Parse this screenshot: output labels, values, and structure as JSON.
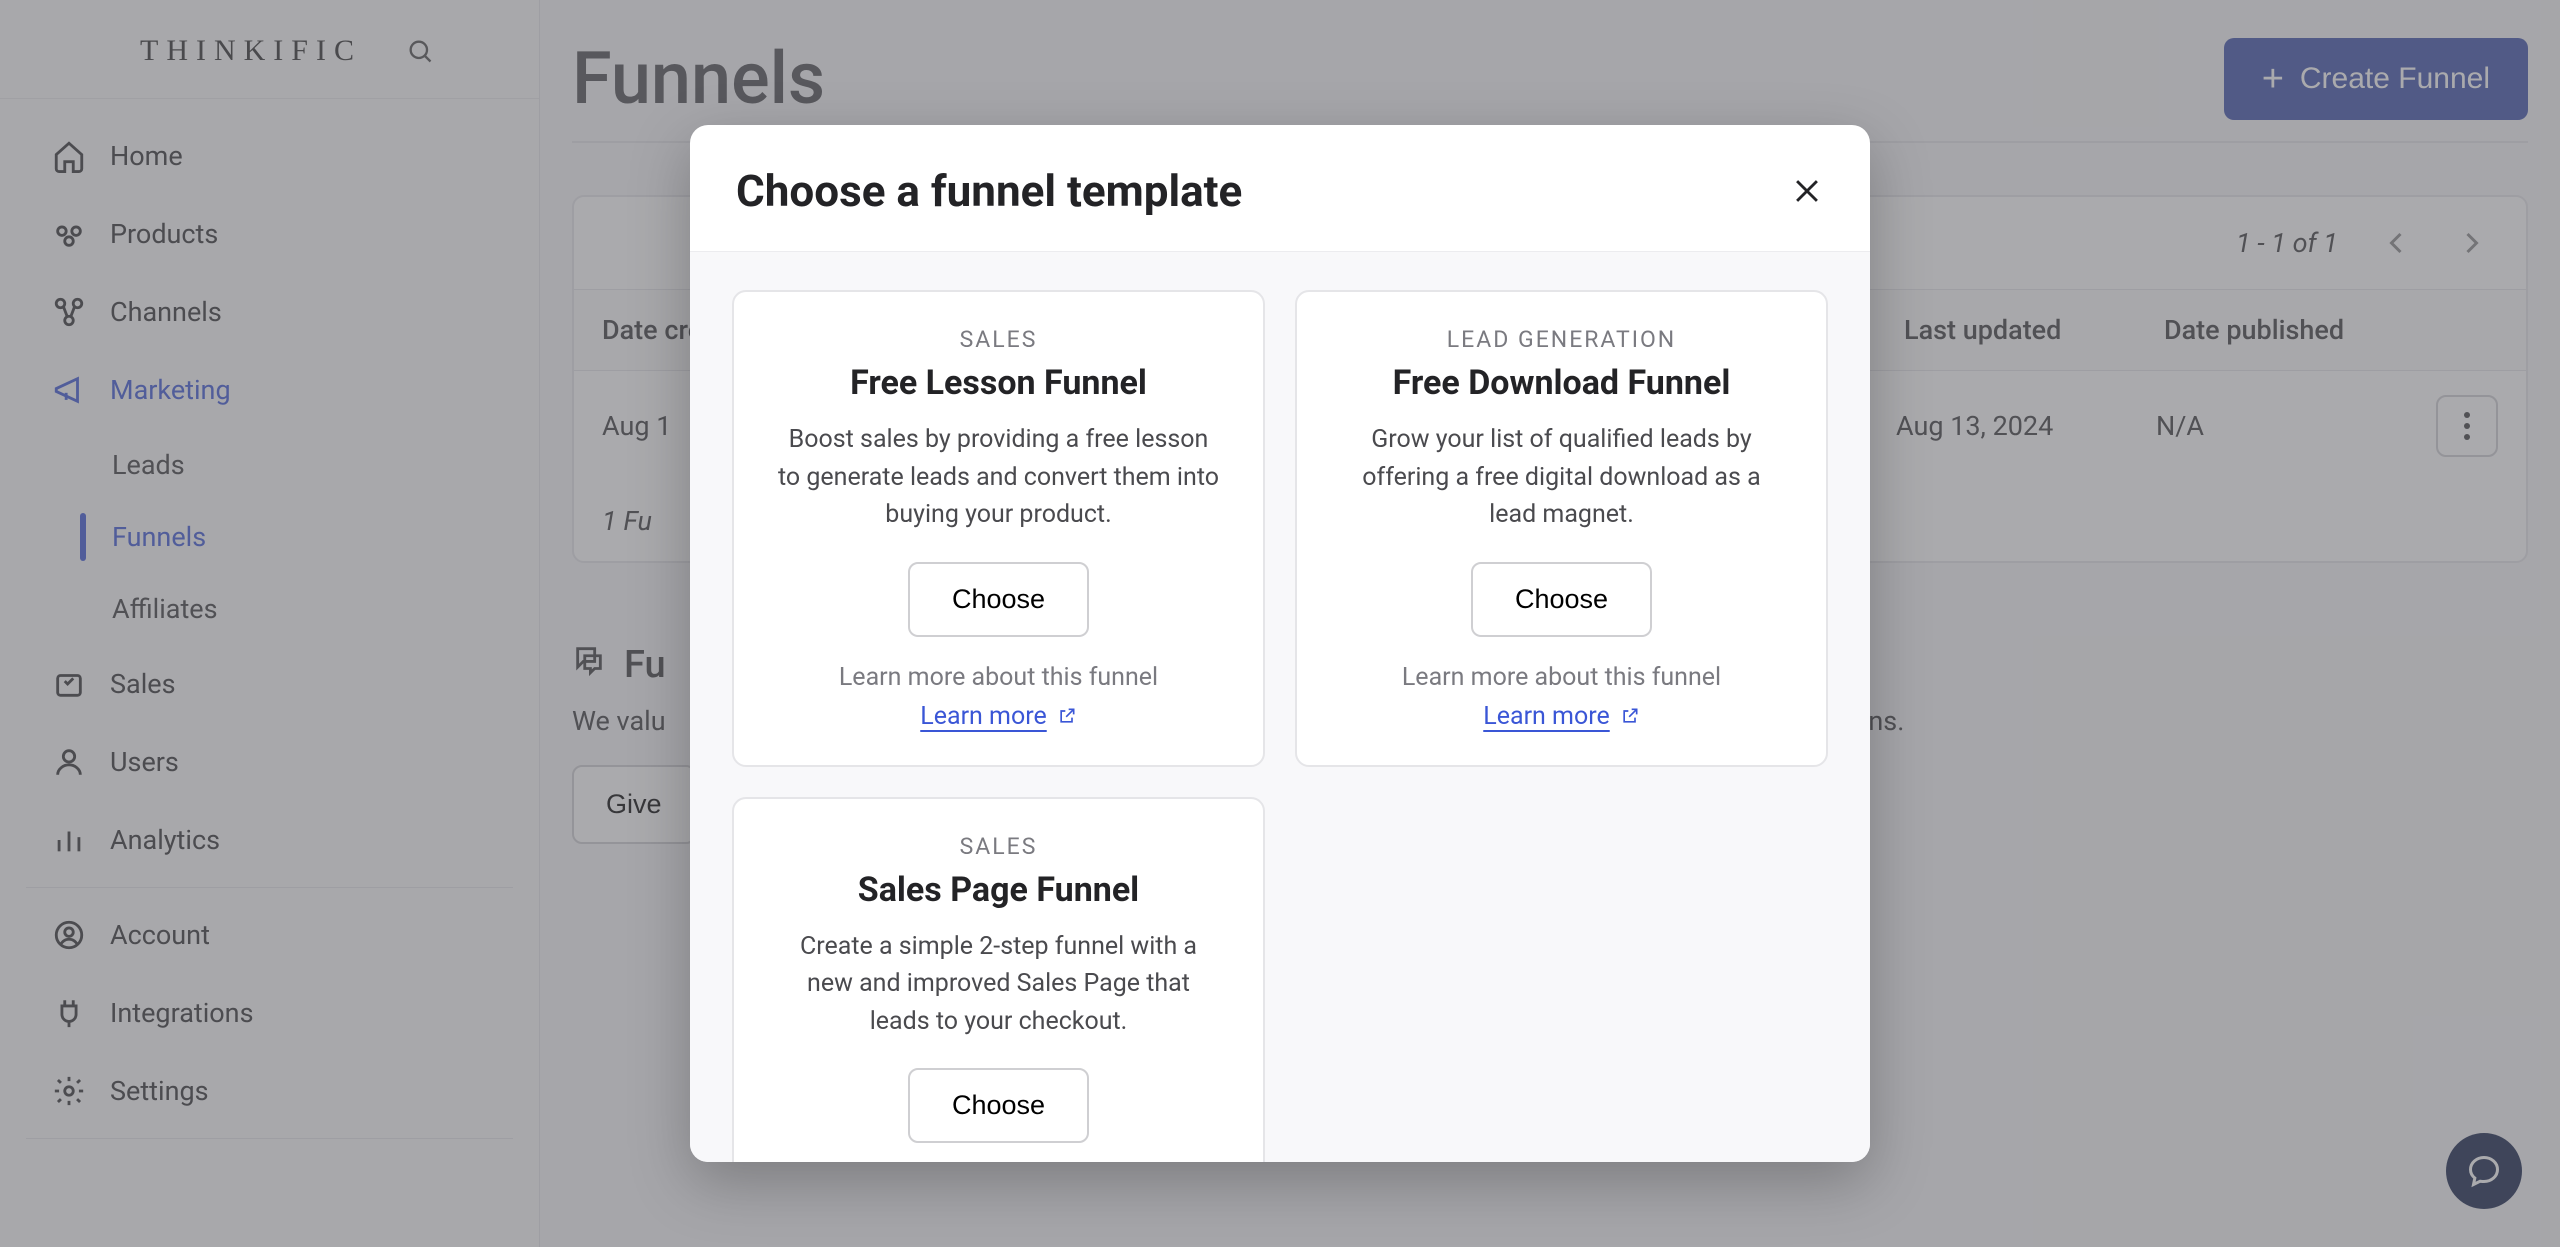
{
  "brand": "THINKIFIC",
  "sidebar": {
    "items": [
      {
        "label": "Home"
      },
      {
        "label": "Products"
      },
      {
        "label": "Channels"
      },
      {
        "label": "Marketing"
      },
      {
        "label": "Sales"
      },
      {
        "label": "Users"
      },
      {
        "label": "Analytics"
      },
      {
        "label": "Account"
      },
      {
        "label": "Integrations"
      },
      {
        "label": "Settings"
      }
    ],
    "marketing_sub": [
      {
        "label": "Leads"
      },
      {
        "label": "Funnels"
      },
      {
        "label": "Affiliates"
      }
    ]
  },
  "page": {
    "title": "Funnels",
    "create_btn": "Create Funnel",
    "pager": "1 - 1 of 1",
    "columns": {
      "date_created": "Date created",
      "last_updated": "Last updated",
      "date_published": "Date published"
    },
    "row": {
      "date_created": "Aug 1",
      "last_updated": "Aug 13, 2024",
      "date_published": "N/A"
    },
    "footer_count": "1 Fu",
    "feedback_title": "Fu",
    "feedback_text_prefix": "We valu",
    "feedback_text_suffix": "ggestions.",
    "feedback_btn": "Give"
  },
  "modal": {
    "title": "Choose a funnel template",
    "cards": [
      {
        "category": "SALES",
        "title": "Free Lesson Funnel",
        "desc": "Boost sales by providing a free lesson to generate leads and convert them into buying your product.",
        "choose": "Choose",
        "learn_label": "Learn more about this funnel",
        "learn_link": "Learn more"
      },
      {
        "category": "LEAD GENERATION",
        "title": "Free Download Funnel",
        "desc": "Grow your list of qualified leads by offering a free digital download as a lead magnet.",
        "choose": "Choose",
        "learn_label": "Learn more about this funnel",
        "learn_link": "Learn more"
      },
      {
        "category": "SALES",
        "title": "Sales Page Funnel",
        "desc": "Create a simple 2-step funnel with a new and improved Sales Page that leads to your checkout.",
        "choose": "Choose"
      }
    ]
  }
}
